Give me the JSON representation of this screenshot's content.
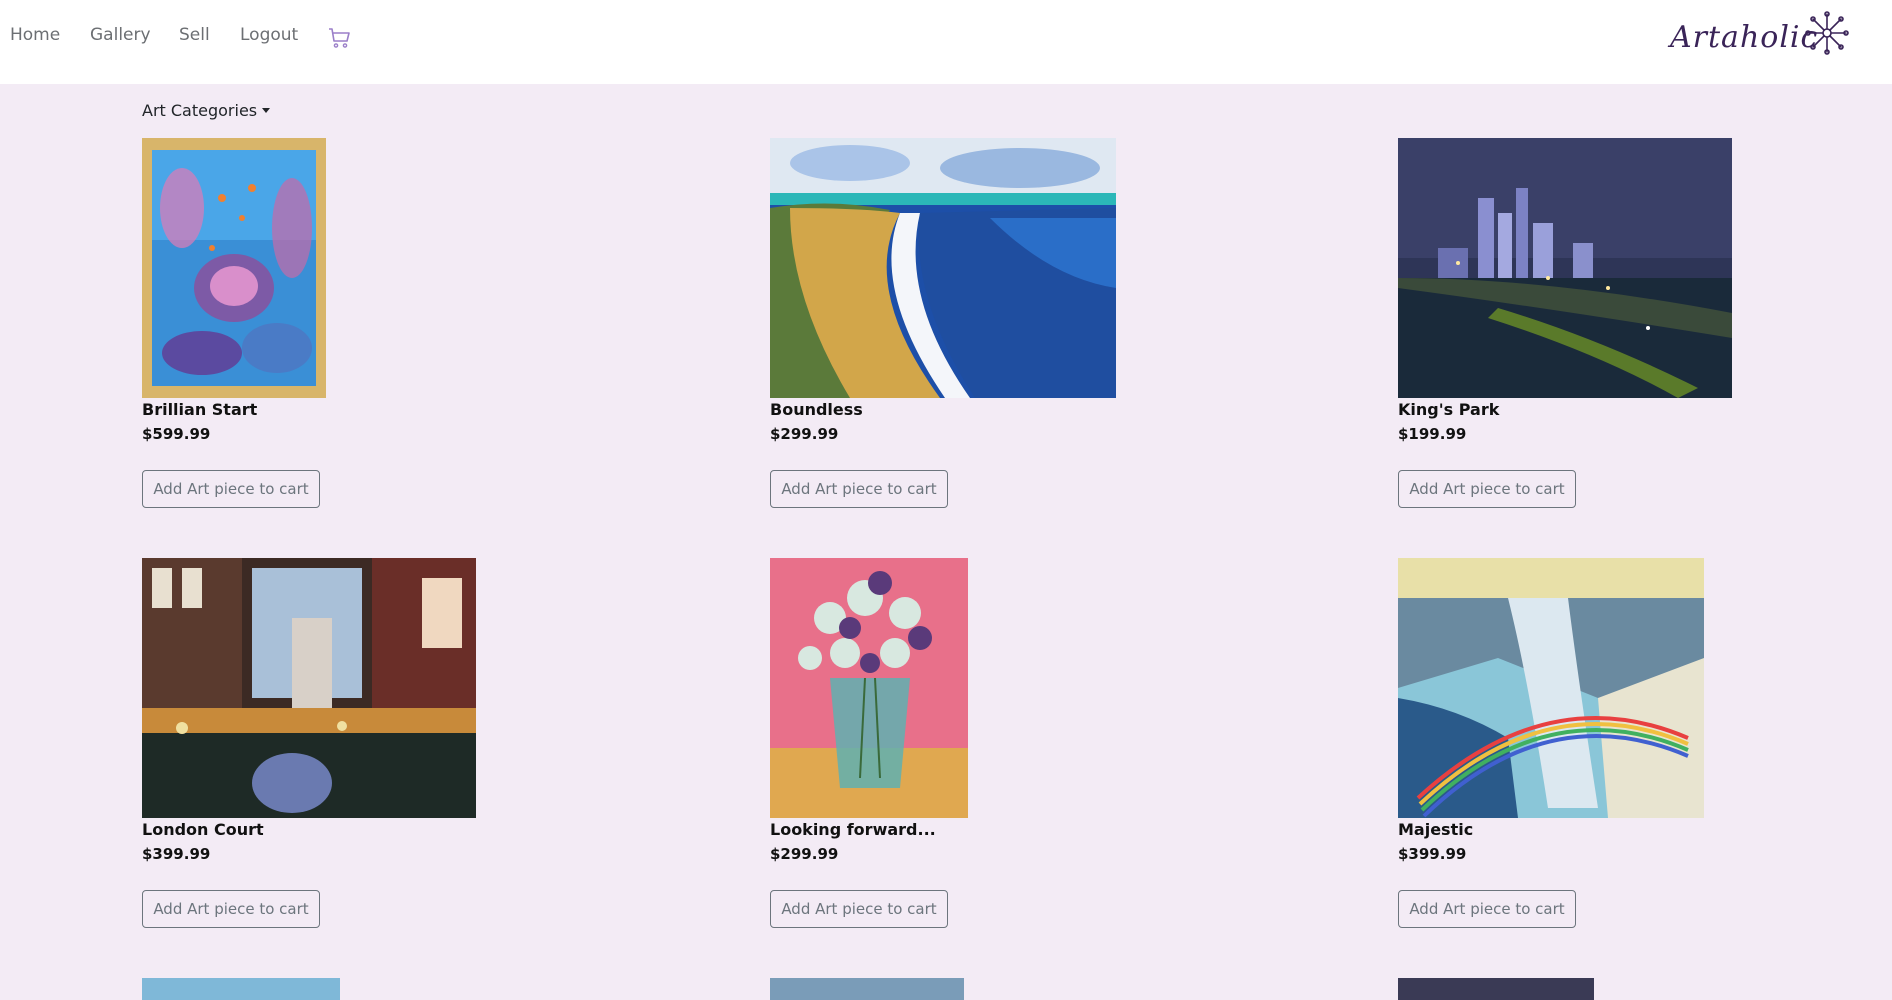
{
  "nav": {
    "links": [
      "Home",
      "Gallery",
      "Sell",
      "Logout"
    ],
    "cart_icon": "shopping-cart-icon"
  },
  "brand": {
    "name": "Artaholic",
    "icon": "starburst-logo-icon"
  },
  "filter": {
    "label": "Art Categories"
  },
  "products": [
    {
      "title": "Brillian Start",
      "price": "$599.99",
      "button": "Add Art piece to cart",
      "image": "underwater-reef-painting"
    },
    {
      "title": "Boundless",
      "price": "$299.99",
      "button": "Add Art piece to cart",
      "image": "coastal-beach-painting"
    },
    {
      "title": "King's Park",
      "price": "$199.99",
      "button": "Add Art piece to cart",
      "image": "night-city-skyline-painting"
    },
    {
      "title": "London Court",
      "price": "$399.99",
      "button": "Add Art piece to cart",
      "image": "street-market-painting"
    },
    {
      "title": "Looking forward...",
      "price": "$299.99",
      "button": "Add Art piece to cart",
      "image": "flower-vase-painting"
    },
    {
      "title": "Majestic",
      "price": "$399.99",
      "button": "Add Art piece to cart",
      "image": "waterfall-rainbow-painting"
    }
  ],
  "colors": {
    "background": "#f3ebf5",
    "navbar": "#ffffff",
    "cart_icon": "#9b7fc9",
    "logo": "#3a2458"
  }
}
